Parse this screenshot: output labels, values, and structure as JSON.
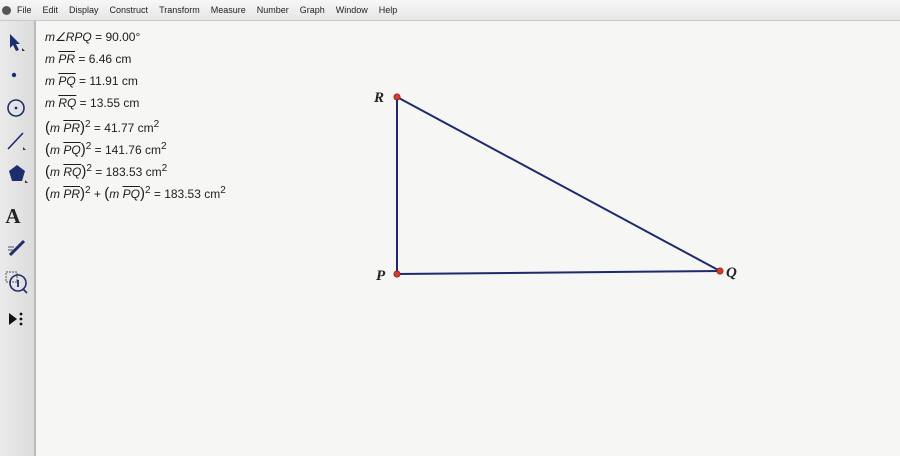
{
  "menubar": {
    "items": [
      "File",
      "Edit",
      "Display",
      "Construct",
      "Transform",
      "Measure",
      "Number",
      "Graph",
      "Window",
      "Help"
    ]
  },
  "toolbox": {
    "tools": [
      {
        "name": "arrow-tool",
        "icon": "arrow-icon"
      },
      {
        "name": "point-tool",
        "icon": "point-icon"
      },
      {
        "name": "compass-tool",
        "icon": "circle-icon"
      },
      {
        "name": "straightedge-tool",
        "icon": "line-icon"
      },
      {
        "name": "polygon-tool",
        "icon": "polygon-icon"
      },
      {
        "name": "text-tool",
        "icon": "text-a-icon",
        "glyph": "A"
      },
      {
        "name": "marker-tool",
        "icon": "marker-icon"
      },
      {
        "name": "information-tool",
        "icon": "info-icon"
      },
      {
        "name": "custom-tool",
        "icon": "custom-tools-icon"
      }
    ]
  },
  "measurements": {
    "angle_rpq": {
      "label": "m∠RPQ",
      "value": "90.00°"
    },
    "len_pr": {
      "prefix": "m",
      "segment": "PR",
      "value": "6.46 cm"
    },
    "len_pq": {
      "prefix": "m",
      "segment": "PQ",
      "value": "11.91 cm"
    },
    "len_rq": {
      "prefix": "m",
      "segment": "RQ",
      "value": "13.55 cm"
    },
    "sq_pr": {
      "segment": "PR",
      "value": "41.77 cm"
    },
    "sq_pq": {
      "segment": "PQ",
      "value": "141.76 cm"
    },
    "sq_rq": {
      "segment": "RQ",
      "value": "183.53 cm"
    },
    "sum_sq": {
      "segment_a": "PR",
      "segment_b": "PQ",
      "value": "183.53 cm"
    }
  },
  "construction": {
    "points": {
      "R": "R",
      "P": "P",
      "Q": "Q"
    },
    "line_color": "#1e2a6e",
    "point_color": "#d63a2a"
  }
}
